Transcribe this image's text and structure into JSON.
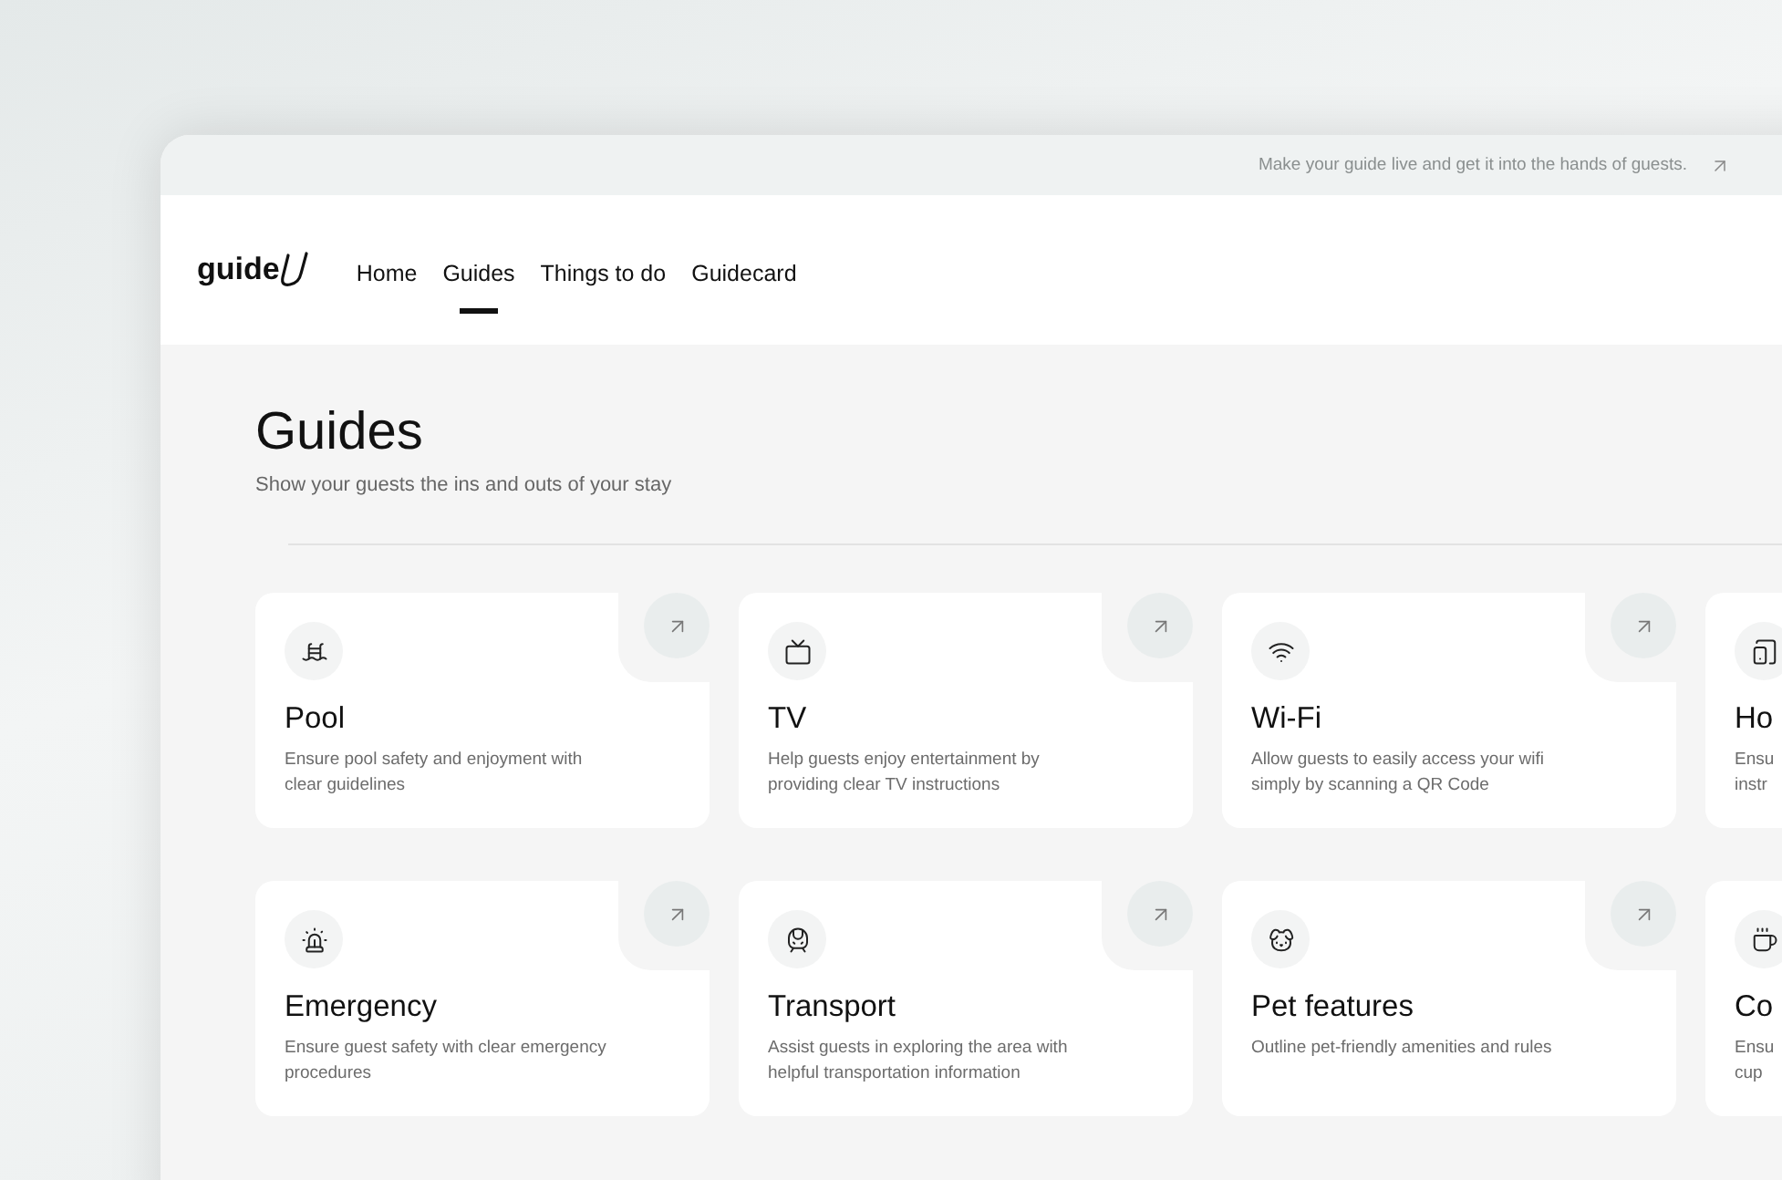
{
  "banner": {
    "text": "Make your guide live and get it into the hands of guests."
  },
  "logo": {
    "text": "guide"
  },
  "nav": [
    {
      "label": "Home",
      "selected": false
    },
    {
      "label": "Guides",
      "selected": true
    },
    {
      "label": "Things to do",
      "selected": false
    },
    {
      "label": "Guidecard",
      "selected": false
    }
  ],
  "page": {
    "title": "Guides",
    "subtitle": "Show your guests the ins and outs of your stay"
  },
  "cards": [
    {
      "title": "Pool",
      "open_button": true,
      "description": [
        "Ensure pool safety and enjoyment with",
        "clear guidelines"
      ]
    },
    {
      "title": "TV",
      "open_button": true,
      "description": [
        "Help guests enjoy entertainment by",
        "providing clear TV instructions"
      ]
    },
    {
      "title": "Wi-Fi",
      "open_button": true,
      "description": [
        "Allow guests to easily access your wifi",
        "simply by scanning a QR Code"
      ]
    },
    {
      "title": "Ho",
      "open_button": false,
      "description": [
        "Ensu",
        "instr"
      ]
    },
    {
      "title": "Emergency",
      "open_button": true,
      "description": [
        "Ensure guest safety with clear emergency",
        "procedures"
      ]
    },
    {
      "title": "Transport",
      "open_button": true,
      "description": [
        "Assist guests in exploring the area with",
        "helpful transportation information"
      ]
    },
    {
      "title": "Pet features",
      "open_button": true,
      "description": [
        "Outline pet-friendly amenities and rules"
      ]
    },
    {
      "title": "Co",
      "open_button": false,
      "description": [
        "Ensu",
        "cup"
      ]
    }
  ]
}
